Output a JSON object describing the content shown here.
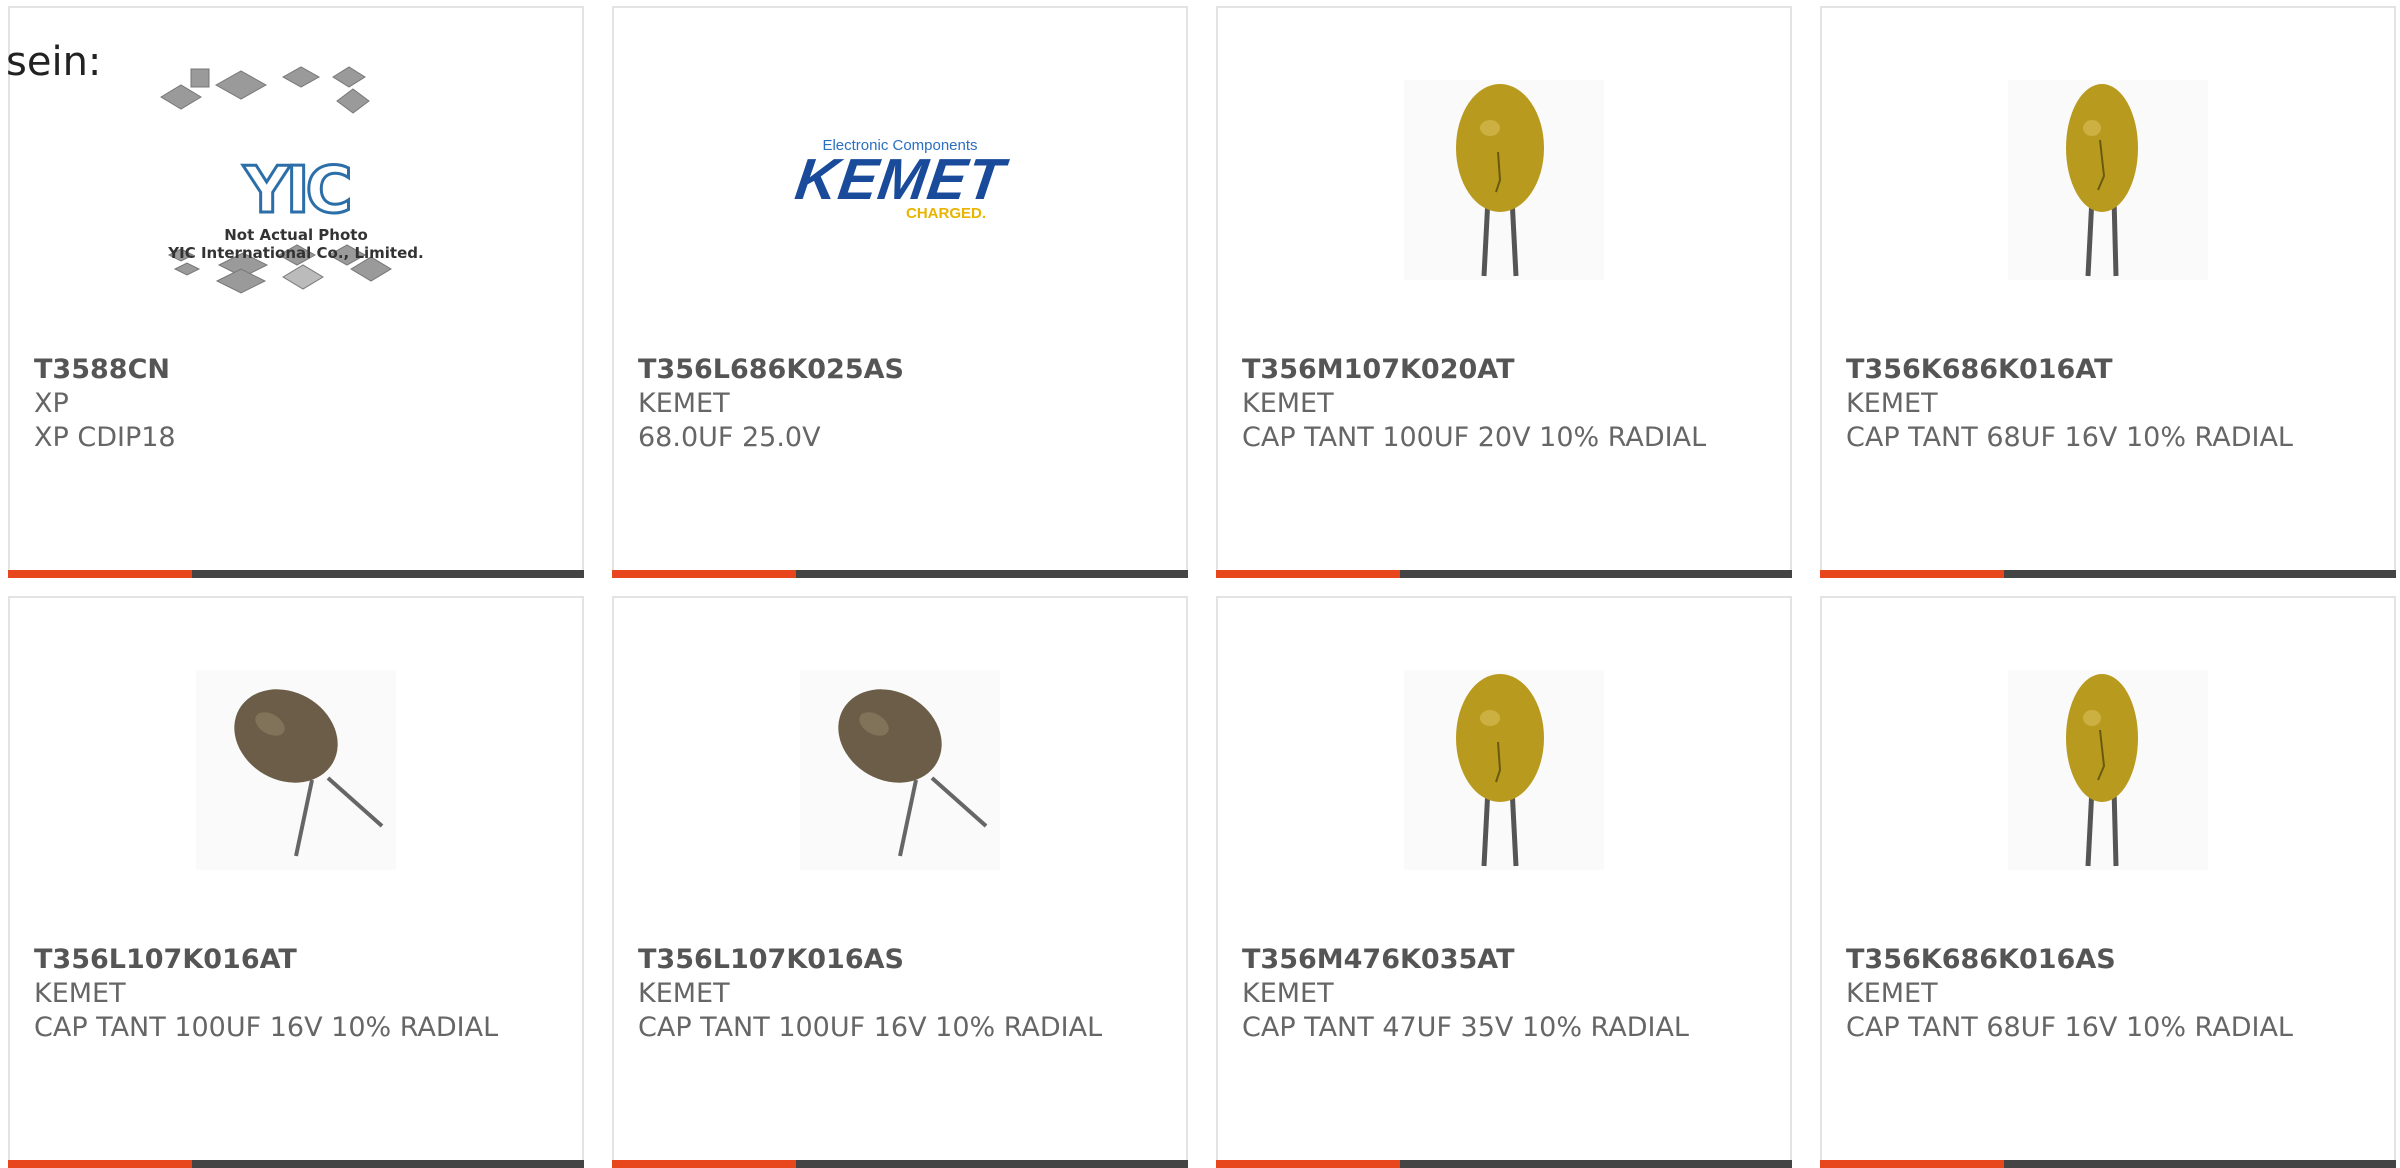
{
  "heading": "sein:",
  "colors": {
    "accent": "#e8461c",
    "bar": "#444444",
    "border": "#e3e3e3"
  },
  "products": [
    {
      "part": "T3588CN",
      "manufacturer": "XP",
      "description": "XP CDIP18",
      "image": "yic-placeholder",
      "placeholder_text": [
        "Not Actual Photo",
        "YIC International Co., Limited."
      ],
      "logo_text": "YIC"
    },
    {
      "part": "T356L686K025AS",
      "manufacturer": "KEMET",
      "description": "68.0UF 25.0V",
      "image": "kemet-logo",
      "logo_text": "KEMET",
      "logo_top": "Electronic Components",
      "logo_bottom": "CHARGED."
    },
    {
      "part": "T356M107K020AT",
      "manufacturer": "KEMET",
      "description": "CAP TANT 100UF 20V 10% RADIAL",
      "image": "yellow-tantalum-capacitor"
    },
    {
      "part": "T356K686K016AT",
      "manufacturer": "KEMET",
      "description": "CAP TANT 68UF 16V 10% RADIAL",
      "image": "yellow-tantalum-capacitor"
    },
    {
      "part": "T356L107K016AT",
      "manufacturer": "KEMET",
      "description": "CAP TANT 100UF 16V 10% RADIAL",
      "image": "brown-tantalum-capacitor"
    },
    {
      "part": "T356L107K016AS",
      "manufacturer": "KEMET",
      "description": "CAP TANT 100UF 16V 10% RADIAL",
      "image": "brown-tantalum-capacitor"
    },
    {
      "part": "T356M476K035AT",
      "manufacturer": "KEMET",
      "description": "CAP TANT 47UF 35V 10% RADIAL",
      "image": "yellow-tantalum-capacitor"
    },
    {
      "part": "T356K686K016AS",
      "manufacturer": "KEMET",
      "description": "CAP TANT 68UF 16V 10% RADIAL",
      "image": "yellow-tantalum-capacitor"
    }
  ]
}
